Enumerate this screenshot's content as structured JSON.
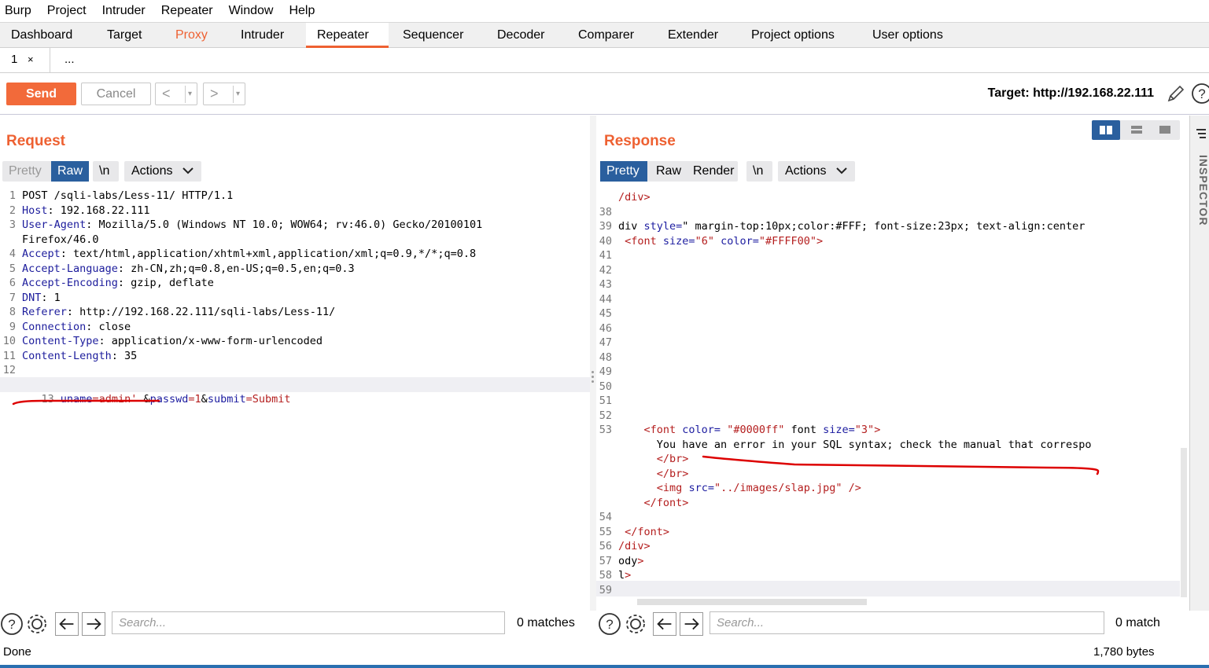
{
  "menubar": [
    "Burp",
    "Project",
    "Intruder",
    "Repeater",
    "Window",
    "Help"
  ],
  "tabs": [
    "Dashboard",
    "Target",
    "Proxy",
    "Intruder",
    "Repeater",
    "Sequencer",
    "Decoder",
    "Comparer",
    "Extender",
    "Project options",
    "User options"
  ],
  "active_tab": "Repeater",
  "subtabs": {
    "tab1": "1",
    "close": "×",
    "more": "..."
  },
  "toolbar": {
    "send": "Send",
    "cancel": "Cancel",
    "back": "<",
    "forward": ">",
    "dropdown": "▾",
    "target": "Target: http://192.168.22.111"
  },
  "request": {
    "title": "Request",
    "modes": {
      "pretty": "Pretty",
      "raw": "Raw",
      "newline": "\\n",
      "actions": "Actions"
    },
    "lines": [
      {
        "n": "1",
        "k": "",
        "v": "POST /sqli-labs/Less-11/ HTTP/1.1"
      },
      {
        "n": "2",
        "k": "Host",
        "v": ": 192.168.22.111"
      },
      {
        "n": "3",
        "k": "User-Agent",
        "v": ": Mozilla/5.0 (Windows NT 10.0; WOW64; rv:46.0) Gecko/20100101"
      },
      {
        "n": "",
        "k": "",
        "v": "Firefox/46.0"
      },
      {
        "n": "4",
        "k": "Accept",
        "v": ": text/html,application/xhtml+xml,application/xml;q=0.9,*/*;q=0.8"
      },
      {
        "n": "5",
        "k": "Accept-Language",
        "v": ": zh-CN,zh;q=0.8,en-US;q=0.5,en;q=0.3"
      },
      {
        "n": "6",
        "k": "Accept-Encoding",
        "v": ": gzip, deflate"
      },
      {
        "n": "7",
        "k": "DNT",
        "v": ": 1"
      },
      {
        "n": "8",
        "k": "Referer",
        "v": ": http://192.168.22.111/sqli-labs/Less-11/"
      },
      {
        "n": "9",
        "k": "Connection",
        "v": ": close"
      },
      {
        "n": "10",
        "k": "Content-Type",
        "v": ": application/x-www-form-urlencoded"
      },
      {
        "n": "11",
        "k": "Content-Length",
        "v": ": 35"
      },
      {
        "n": "12",
        "k": "",
        "v": ""
      }
    ],
    "body_line": {
      "n": "13",
      "p1": "uname",
      "e1": "=",
      "v1": "admin'",
      "s1": " &",
      "p2": "passwd",
      "e2": "=",
      "v2": "1",
      "s2": "&",
      "p3": "submit",
      "e3": "=",
      "v3": "Submit"
    }
  },
  "response": {
    "title": "Response",
    "modes": {
      "pretty": "Pretty",
      "raw": "Raw",
      "render": "Render",
      "newline": "\\n",
      "actions": "Actions"
    },
    "lines": [
      {
        "n": "",
        "c": "",
        "t": "/div>"
      },
      {
        "n": "38",
        "c": "",
        "t": ""
      },
      {
        "n": "39",
        "c": "",
        "t": "div style=\" margin-top:10px;color:#FFF; font-size:23px; text-align:center"
      },
      {
        "n": "40",
        "c": "",
        "t": " <font size=\"6\" color=\"#FFFF00\">"
      },
      {
        "n": "41",
        "c": "",
        "t": ""
      },
      {
        "n": "42",
        "c": "",
        "t": ""
      },
      {
        "n": "43",
        "c": "",
        "t": ""
      },
      {
        "n": "44",
        "c": "",
        "t": ""
      },
      {
        "n": "45",
        "c": "",
        "t": ""
      },
      {
        "n": "46",
        "c": "",
        "t": ""
      },
      {
        "n": "47",
        "c": "",
        "t": ""
      },
      {
        "n": "48",
        "c": "",
        "t": ""
      },
      {
        "n": "49",
        "c": "",
        "t": ""
      },
      {
        "n": "50",
        "c": "",
        "t": ""
      },
      {
        "n": "51",
        "c": "",
        "t": ""
      },
      {
        "n": "52",
        "c": "",
        "t": ""
      },
      {
        "n": "53",
        "c": "",
        "t": "    <font color= \"#0000ff\" font size=\"3\">"
      },
      {
        "n": "",
        "c": "",
        "t": "      You have an error in your SQL syntax; check the manual that correspo"
      },
      {
        "n": "",
        "c": "",
        "t": "      </br>"
      },
      {
        "n": "",
        "c": "",
        "t": "      </br>"
      },
      {
        "n": "",
        "c": "",
        "t": "      <img src=\"../images/slap.jpg\" />"
      },
      {
        "n": "",
        "c": "",
        "t": "    </font>"
      },
      {
        "n": "54",
        "c": "",
        "t": ""
      },
      {
        "n": "55",
        "c": "",
        "t": " </font>"
      },
      {
        "n": "56",
        "c": "",
        "t": "/div>"
      },
      {
        "n": "57",
        "c": "",
        "t": "ody>"
      },
      {
        "n": "58",
        "c": "",
        "t": "l>"
      },
      {
        "n": "59",
        "c": "",
        "t": ""
      }
    ]
  },
  "inspector": "INSPECTOR",
  "search": {
    "placeholder": "Search...",
    "left_matches": "0 matches",
    "right_matches": "0 match"
  },
  "status": {
    "left": "Done",
    "right": "1,780 bytes"
  },
  "colors": {
    "accent": "#ee6132",
    "blue": "#2a5f9e"
  }
}
